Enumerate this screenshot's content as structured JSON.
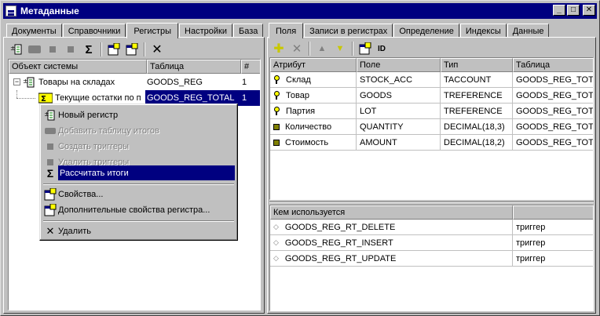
{
  "window": {
    "title": "Метаданные"
  },
  "left": {
    "tabs": [
      "Документы",
      "Справочники",
      "Регистры",
      "Настройки",
      "База"
    ],
    "active_tab": 2,
    "columns": [
      "Объект системы",
      "Таблица",
      "#"
    ],
    "tree": [
      {
        "label": "Товары на складах",
        "table": "GOODS_REG",
        "num": "1"
      },
      {
        "label": "Текущие остатки по п",
        "table": "GOODS_REG_TOTAL",
        "num": "1"
      }
    ]
  },
  "context_menu": {
    "items": [
      {
        "label": "Новый регистр",
        "enabled": true
      },
      {
        "label": "Добавить таблицу итогов",
        "enabled": false
      },
      {
        "label": "Создать триггеры",
        "enabled": false
      },
      {
        "label": "Удалить триггеры",
        "enabled": false
      },
      {
        "label": "Рассчитать итоги",
        "enabled": true,
        "highlighted": true
      },
      {
        "label": "Свойства...",
        "enabled": true
      },
      {
        "label": "Дополнительные свойства регистра...",
        "enabled": true
      },
      {
        "label": "Удалить",
        "enabled": true
      }
    ]
  },
  "right": {
    "tabs": [
      "Поля",
      "Записи в регистрах",
      "Определение",
      "Индексы",
      "Данные"
    ],
    "active_tab": 0,
    "toolbar_id_label": "ID",
    "columns": [
      "Атрибут",
      "Поле",
      "Тип",
      "Таблица"
    ],
    "rows": [
      {
        "icon": "key-icon",
        "attr": "Склад",
        "field": "STOCK_ACC",
        "type": "TACCOUNT",
        "table": "GOODS_REG_TOTAL"
      },
      {
        "icon": "key-icon",
        "attr": "Товар",
        "field": "GOODS",
        "type": "TREFERENCE",
        "table": "GOODS_REG_TOTAL"
      },
      {
        "icon": "key-icon",
        "attr": "Партия",
        "field": "LOT",
        "type": "TREFERENCE",
        "table": "GOODS_REG_TOTAL"
      },
      {
        "icon": "square-icon",
        "attr": "Количество",
        "field": "QUANTITY",
        "type": "DECIMAL(18,3)",
        "table": "GOODS_REG_TOTAL"
      },
      {
        "icon": "square-icon",
        "attr": "Стоимость",
        "field": "AMOUNT",
        "type": "DECIMAL(18,2)",
        "table": "GOODS_REG_TOTAL"
      }
    ],
    "used_by": {
      "columns": [
        "Кем используется",
        ""
      ],
      "rows": [
        {
          "name": "GOODS_REG_RT_DELETE",
          "kind": "триггер"
        },
        {
          "name": "GOODS_REG_RT_INSERT",
          "kind": "триггер"
        },
        {
          "name": "GOODS_REG_RT_UPDATE",
          "kind": "триггер"
        }
      ]
    }
  }
}
